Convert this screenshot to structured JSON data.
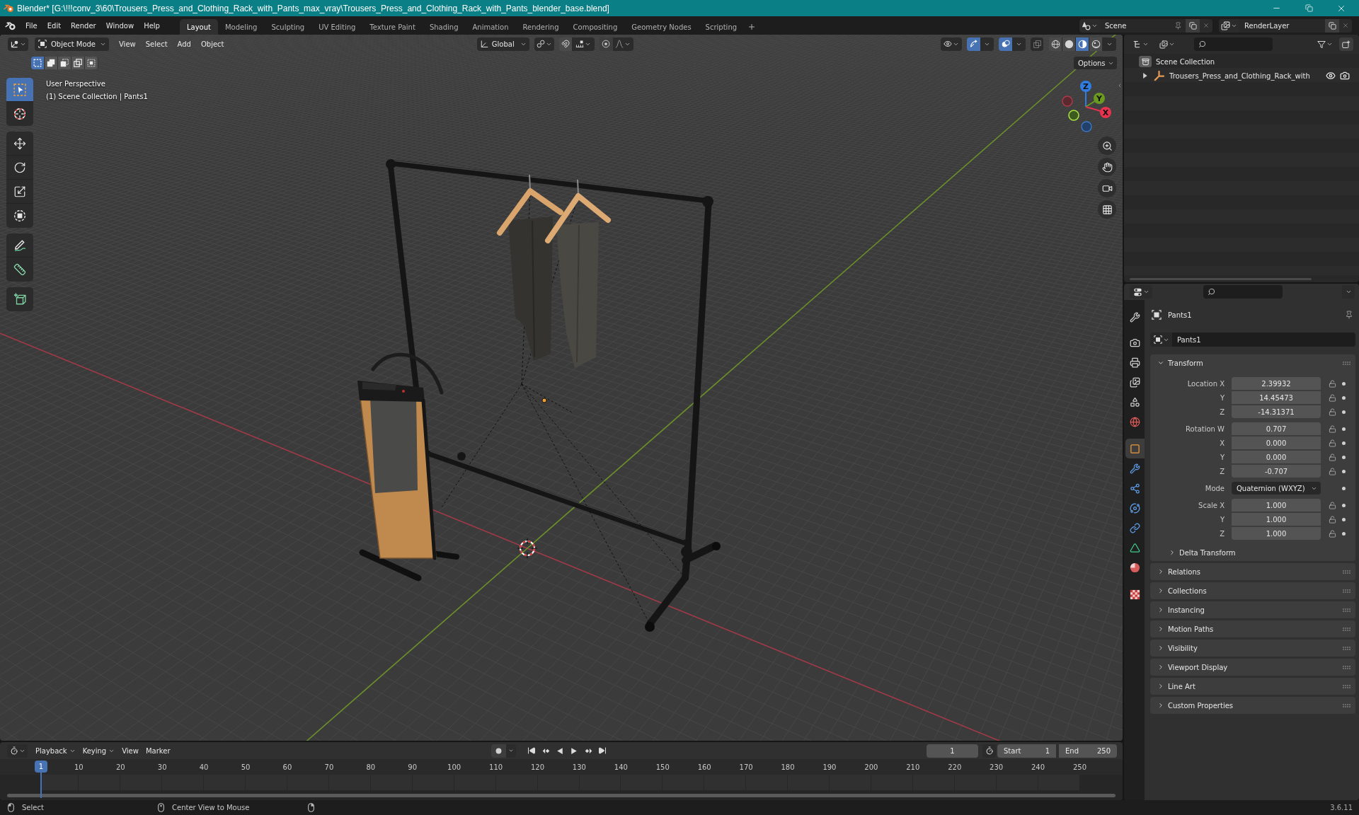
{
  "window": {
    "title": "Blender* [G:\\!!!conv_3\\60\\Trousers_Press_and_Clothing_Rack_with_Pants_max_vray\\Trousers_Press_and_Clothing_Rack_with_Pants_blender_base.blend]"
  },
  "menu": [
    "File",
    "Edit",
    "Render",
    "Window",
    "Help"
  ],
  "workspaces": [
    {
      "label": "Layout",
      "selected": true
    },
    {
      "label": "Modeling",
      "selected": false
    },
    {
      "label": "Sculpting",
      "selected": false
    },
    {
      "label": "UV Editing",
      "selected": false
    },
    {
      "label": "Texture Paint",
      "selected": false
    },
    {
      "label": "Shading",
      "selected": false
    },
    {
      "label": "Animation",
      "selected": false
    },
    {
      "label": "Rendering",
      "selected": false
    },
    {
      "label": "Compositing",
      "selected": false
    },
    {
      "label": "Geometry Nodes",
      "selected": false
    },
    {
      "label": "Scripting",
      "selected": false
    }
  ],
  "scene": {
    "name": "Scene"
  },
  "view_layer": {
    "name": "RenderLayer"
  },
  "viewport": {
    "mode": "Object Mode",
    "menus": [
      "View",
      "Select",
      "Add",
      "Object"
    ],
    "orientation": "Global",
    "snap_on": false,
    "proportional_on": false,
    "gizmos_on": true,
    "overlays_on": true,
    "xray_on": false,
    "shading": [
      {
        "selected": false
      },
      {
        "selected": false
      },
      {
        "selected": true
      },
      {
        "selected": false
      }
    ],
    "select_modes": [
      {
        "selected": true
      },
      {
        "selected": false
      },
      {
        "selected": false
      },
      {
        "selected": false
      },
      {
        "selected": false
      }
    ],
    "options": "Options",
    "view_name": "User Perspective",
    "collection_info": "(1) Scene Collection | Pants1",
    "tools": [
      {
        "selected": true
      },
      {
        "selected": false
      },
      {
        "selected": false
      },
      {
        "selected": false
      },
      {
        "selected": false
      },
      {
        "selected": false
      },
      {
        "selected": false
      },
      {
        "selected": false
      },
      {
        "selected": false
      }
    ],
    "gizmo_axes": [
      "Z",
      "Y",
      "X"
    ]
  },
  "outliner": {
    "items": [
      {
        "label": "Scene Collection",
        "children": [
          {
            "label": "Trousers_Press_and_Clothing_Rack_with",
            "expanded": false,
            "visible": true,
            "renderable": true
          }
        ]
      }
    ]
  },
  "properties": {
    "tabs": [
      {
        "selected": false
      },
      {
        "selected": false
      },
      {
        "selected": false
      },
      {
        "selected": false
      },
      {
        "selected": false
      },
      {
        "selected": false
      },
      {
        "selected": true
      },
      {
        "selected": false
      },
      {
        "selected": false
      },
      {
        "selected": false
      },
      {
        "selected": false
      },
      {
        "selected": false
      },
      {
        "selected": false
      },
      {
        "selected": false
      }
    ],
    "object": "Pants1",
    "name": "Pants1",
    "panels": [
      {
        "title": "Transform",
        "expanded": true,
        "groups": [
          {
            "fields": [
              {
                "kind": "number",
                "label": "Location X",
                "value": "2.39932",
                "locked": false
              },
              {
                "kind": "number",
                "label": "Y",
                "value": "14.45473",
                "locked": false
              },
              {
                "kind": "number",
                "label": "Z",
                "value": "-14.31371",
                "locked": false
              }
            ]
          },
          {
            "fields": [
              {
                "kind": "number",
                "label": "Rotation W",
                "value": "0.707",
                "locked": false
              },
              {
                "kind": "number",
                "label": "X",
                "value": "0.000",
                "locked": false
              },
              {
                "kind": "number",
                "label": "Y",
                "value": "0.000",
                "locked": false
              },
              {
                "kind": "number",
                "label": "Z",
                "value": "-0.707",
                "locked": false
              }
            ]
          },
          {
            "fields": [
              {
                "kind": "dropdown",
                "label": "Mode",
                "value": "Quaternion (WXYZ)"
              }
            ]
          },
          {
            "fields": [
              {
                "kind": "number",
                "label": "Scale X",
                "value": "1.000",
                "locked": false
              },
              {
                "kind": "number",
                "label": "Y",
                "value": "1.000",
                "locked": false
              },
              {
                "kind": "number",
                "label": "Z",
                "value": "1.000",
                "locked": false
              }
            ]
          }
        ],
        "subpanels": [
          {
            "title": "Delta Transform",
            "expanded": false
          }
        ]
      },
      {
        "title": "Relations",
        "expanded": false
      },
      {
        "title": "Collections",
        "expanded": false
      },
      {
        "title": "Instancing",
        "expanded": false
      },
      {
        "title": "Motion Paths",
        "expanded": false
      },
      {
        "title": "Visibility",
        "expanded": false
      },
      {
        "title": "Viewport Display",
        "expanded": false
      },
      {
        "title": "Line Art",
        "expanded": false
      },
      {
        "title": "Custom Properties",
        "expanded": false
      }
    ]
  },
  "timeline": {
    "menus": [
      {
        "label": "Playback",
        "dropdown": true
      },
      {
        "label": "Keying",
        "dropdown": true
      },
      {
        "label": "View",
        "dropdown": false
      },
      {
        "label": "Marker",
        "dropdown": false
      }
    ],
    "auto_keying_on": false,
    "current_frame": "1",
    "start": {
      "label": "Start",
      "value": "1"
    },
    "end": {
      "label": "End",
      "value": "250"
    },
    "playhead": "1",
    "ruler": [
      "10",
      "20",
      "30",
      "40",
      "50",
      "60",
      "70",
      "80",
      "90",
      "100",
      "110",
      "120",
      "130",
      "140",
      "150",
      "160",
      "170",
      "180",
      "190",
      "200",
      "210",
      "220",
      "230",
      "240",
      "250"
    ]
  },
  "status_bar": {
    "hints": [
      "Select",
      "Center View to Mouse"
    ],
    "version": "3.6.11"
  }
}
